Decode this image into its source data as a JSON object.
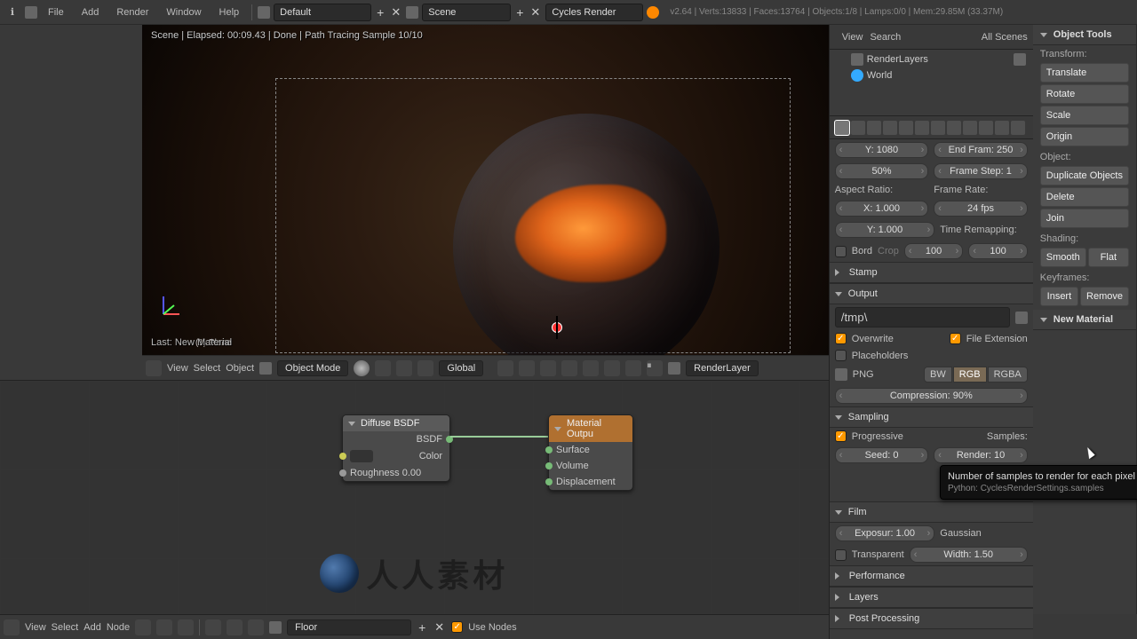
{
  "topbar": {
    "menus": [
      "File",
      "Add",
      "Render",
      "Window",
      "Help"
    ],
    "layout": "Default",
    "scene": "Scene",
    "engine": "Cycles Render",
    "stats": "v2.64 | Verts:13833 | Faces:13764 | Objects:1/8 | Lamps:0/0 | Mem:29.85M (33.37M)"
  },
  "left": {
    "title": "Object Tools",
    "transform_label": "Transform:",
    "translate": "Translate",
    "rotate": "Rotate",
    "scale": "Scale",
    "origin": "Origin",
    "object_label": "Object:",
    "duplicate": "Duplicate Objects",
    "delete": "Delete",
    "join": "Join",
    "shading_label": "Shading:",
    "smooth": "Smooth",
    "flat": "Flat",
    "keyframes_label": "Keyframes:",
    "insert": "Insert",
    "remove": "Remove",
    "new_material": "New Material"
  },
  "viewport": {
    "status": "Scene | Elapsed: 00:09.43 | Done | Path Tracing Sample 10/10",
    "last_op": "Last: New Material",
    "object_name": "(1) Plane",
    "header": {
      "menus": [
        "View",
        "Select",
        "Object"
      ],
      "mode": "Object Mode",
      "orient": "Global",
      "layer": "RenderLayer"
    }
  },
  "nodes": {
    "diffuse": {
      "title": "Diffuse BSDF",
      "out": "BSDF",
      "color": "Color",
      "rough": "Roughness 0.00"
    },
    "output": {
      "title": "Material Outpu",
      "surface": "Surface",
      "volume": "Volume",
      "disp": "Displacement"
    },
    "header": {
      "menus": [
        "View",
        "Select",
        "Add",
        "Node"
      ],
      "material": "Floor",
      "use_nodes": "Use Nodes"
    }
  },
  "outliner": {
    "header": {
      "view": "View",
      "search": "Search",
      "filter": "All Scenes"
    },
    "items": [
      {
        "icon": "render-icon",
        "label": "RenderLayers"
      },
      {
        "icon": "world-icon",
        "label": "World"
      }
    ]
  },
  "props": {
    "dims": {
      "y": "Y: 1080",
      "end": "End Fram: 250",
      "pct": "50%",
      "step": "Frame Step: 1"
    },
    "aspect_label": "Aspect Ratio:",
    "framerate_label": "Frame Rate:",
    "ax": "X: 1.000",
    "ay": "Y: 1.000",
    "fps": "24 fps",
    "remap": "Time Remapping:",
    "bord": "Bord",
    "crop": "Crop",
    "old": "100",
    "new": "100",
    "stamp": "Stamp",
    "output": "Output",
    "path": "/tmp\\",
    "overwrite": "Overwrite",
    "file_ext": "File Extension",
    "placeholders": "Placeholders",
    "format": "PNG",
    "bw": "BW",
    "rgb": "RGB",
    "rgba": "RGBA",
    "compression": "Compression: 90%",
    "sampling": "Sampling",
    "progressive": "Progressive",
    "samples_label": "Samples:",
    "seed": "Seed: 0",
    "render": "Render: 10",
    "film": "Film",
    "exposure": "Exposur: 1.00",
    "filter": "Gaussian",
    "transparent": "Transparent",
    "width": "Width: 1.50",
    "performance": "Performance",
    "layers": "Layers",
    "post": "Post Processing"
  },
  "tooltip": {
    "line1": "Number of samples to render for each pixel",
    "line2": "Python: CyclesRenderSettings.samples"
  },
  "watermark": "人人素材"
}
